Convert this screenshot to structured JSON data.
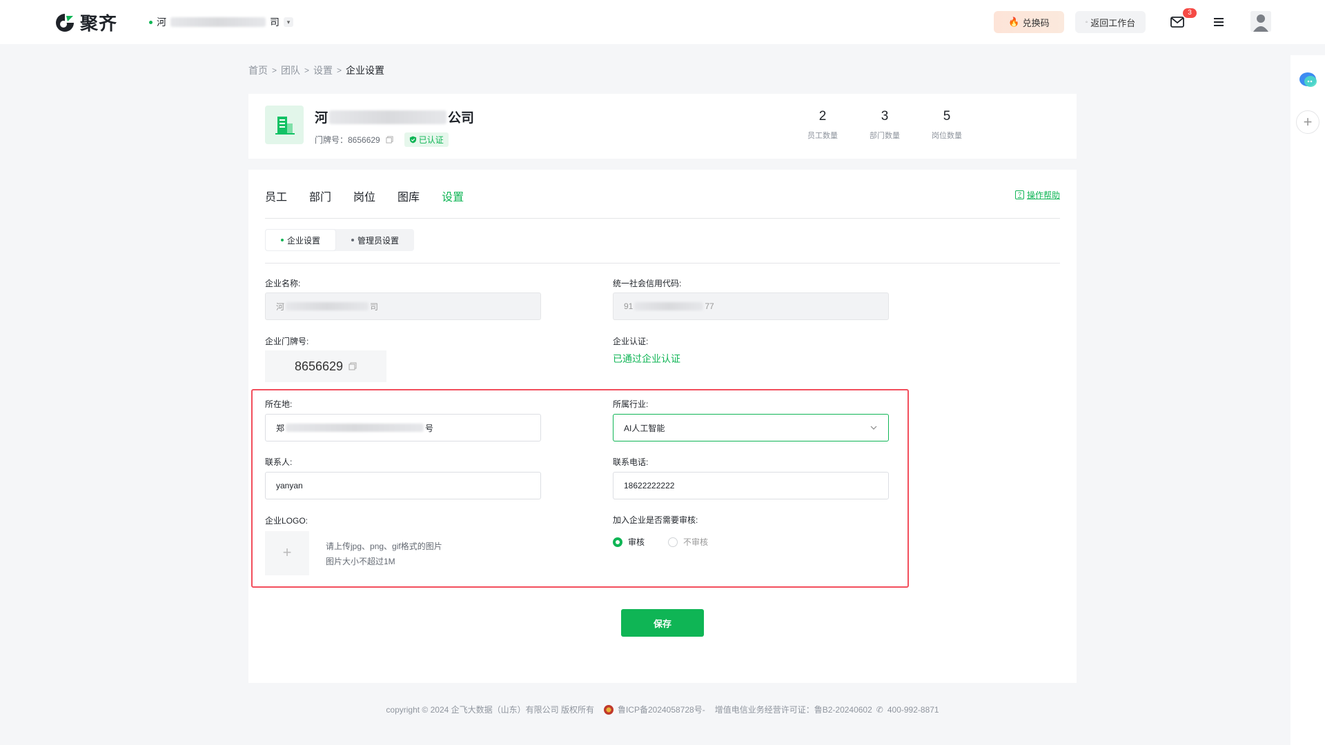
{
  "header": {
    "logo_text": "聚齐",
    "company_prefix": "河",
    "company_suffix": "司",
    "exchange_label": "兑换码",
    "return_label": "返回工作台",
    "mail_badge": "3"
  },
  "breadcrumb": {
    "items": [
      "首页",
      "团队",
      "设置"
    ],
    "current": "企业设置"
  },
  "company": {
    "name_prefix": "河",
    "name_suffix": "公司",
    "doorplate_label": "门牌号：8656629",
    "verified_label": "已认证",
    "stats": [
      {
        "num": "2",
        "label": "员工数量"
      },
      {
        "num": "3",
        "label": "部门数量"
      },
      {
        "num": "5",
        "label": "岗位数量"
      }
    ]
  },
  "tabs": [
    "员工",
    "部门",
    "岗位",
    "图库",
    "设置"
  ],
  "active_tab": "设置",
  "help_label": "操作帮助",
  "subtabs": [
    "企业设置",
    "管理员设置"
  ],
  "form": {
    "name_label": "企业名称:",
    "name_value_prefix": "河",
    "name_value_suffix": "司",
    "credit_label": "统一社会信用代码:",
    "credit_value_prefix": "91",
    "credit_value_suffix": "77",
    "doorplate_label": "企业门牌号:",
    "doorplate_value": "8656629",
    "cert_label": "企业认证:",
    "cert_value": "已通过企业认证",
    "location_label": "所在地:",
    "location_prefix": "郑",
    "location_suffix": "号",
    "industry_label": "所属行业:",
    "industry_value": "AI人工智能",
    "contact_label": "联系人:",
    "contact_value": "yanyan",
    "phone_label": "联系电话:",
    "phone_value": "18622222222",
    "logo_label": "企业LOGO:",
    "logo_tip1": "请上传jpg、png、gif格式的图片",
    "logo_tip2": "图片大小不超过1M",
    "review_label": "加入企业是否需要审核:",
    "review_yes": "审核",
    "review_no": "不审核",
    "save_label": "保存"
  },
  "footer": {
    "copyright": "copyright © 2024 企飞大数据（山东）有限公司 版权所有",
    "icp": "鲁ICP备2024058728号-",
    "license": "增值电信业务经营许可证：鲁B2-20240602",
    "phone": "400-992-8871"
  },
  "colors": {
    "accent": "#0fb555",
    "highlight_border": "#f24e5c",
    "badge": "#f54a45"
  }
}
